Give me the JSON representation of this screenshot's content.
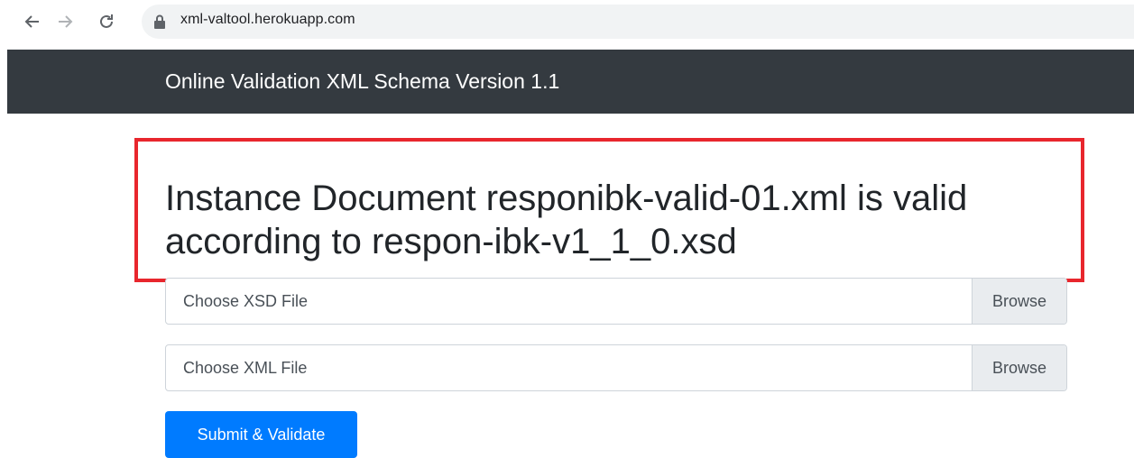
{
  "browser": {
    "url": "xml-valtool.herokuapp.com",
    "back_icon": "arrow-left-icon",
    "forward_icon": "arrow-right-icon",
    "reload_icon": "reload-icon",
    "lock_icon": "lock-icon"
  },
  "header": {
    "title": "Online Validation XML Schema Version 1.1"
  },
  "result": {
    "message": "Instance Document responibk-valid-01.xml is valid according to respon-ibk-v1_1_0.xsd"
  },
  "form": {
    "xsd_label": "Choose XSD File",
    "xml_label": "Choose XML File",
    "browse_label": "Browse",
    "submit_label": "Submit & Validate"
  },
  "colors": {
    "header_bg": "#343a40",
    "highlight_border": "#e8262d",
    "primary": "#007bff"
  }
}
